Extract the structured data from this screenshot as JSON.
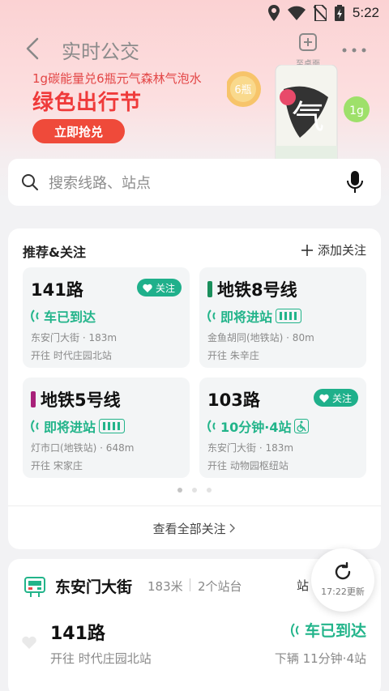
{
  "status_bar": {
    "time": "5:22"
  },
  "nav": {
    "title": "实时公交",
    "add_desktop_label": "至桌面"
  },
  "promo": {
    "subtitle": "1g碳能量兑6瓶元气森林气泡水",
    "title": "绿色出行节",
    "button_label": "立即抢兑",
    "badge_bottles": "6瓶",
    "badge_weight": "1g",
    "can_text": "气"
  },
  "search": {
    "placeholder": "搜索线路、站点"
  },
  "favorites": {
    "title": "推荐&关注",
    "add_label": "添加关注",
    "view_all_label": "查看全部关注",
    "tiles": [
      {
        "name": "141路",
        "follow_label": "关注",
        "status": "车已到达",
        "stop": "东安门大街 · 183m",
        "dest": "开往 时代庄园北站"
      },
      {
        "name": "地铁8号线",
        "line_color": "#1a8f5c",
        "status": "即将进站",
        "stop": "金鱼胡同(地铁站) · 80m",
        "dest": "开往 朱辛庄"
      },
      {
        "name": "地铁5号线",
        "line_color": "#a8217a",
        "status": "即将进站",
        "stop": "灯市口(地铁站) · 648m",
        "dest": "开往 宋家庄"
      },
      {
        "name": "103路",
        "follow_label": "关注",
        "status": "10分钟·4站",
        "stop": "东安门大街 · 183m",
        "dest": "开往 动物园枢纽站"
      }
    ],
    "page_dots": 3,
    "active_page": 0
  },
  "station": {
    "name": "东安门大街",
    "distance": "183米",
    "count": "2个站台",
    "more": "站",
    "route": "141路",
    "dest": "开往 时代庄园北站",
    "status": "车已到达",
    "next": "下辆 11分钟·4站"
  },
  "refresh": {
    "time_label": "17:22更新"
  },
  "colors": {
    "accent_green": "#22b48a",
    "promo_red": "#ef4a3a"
  }
}
